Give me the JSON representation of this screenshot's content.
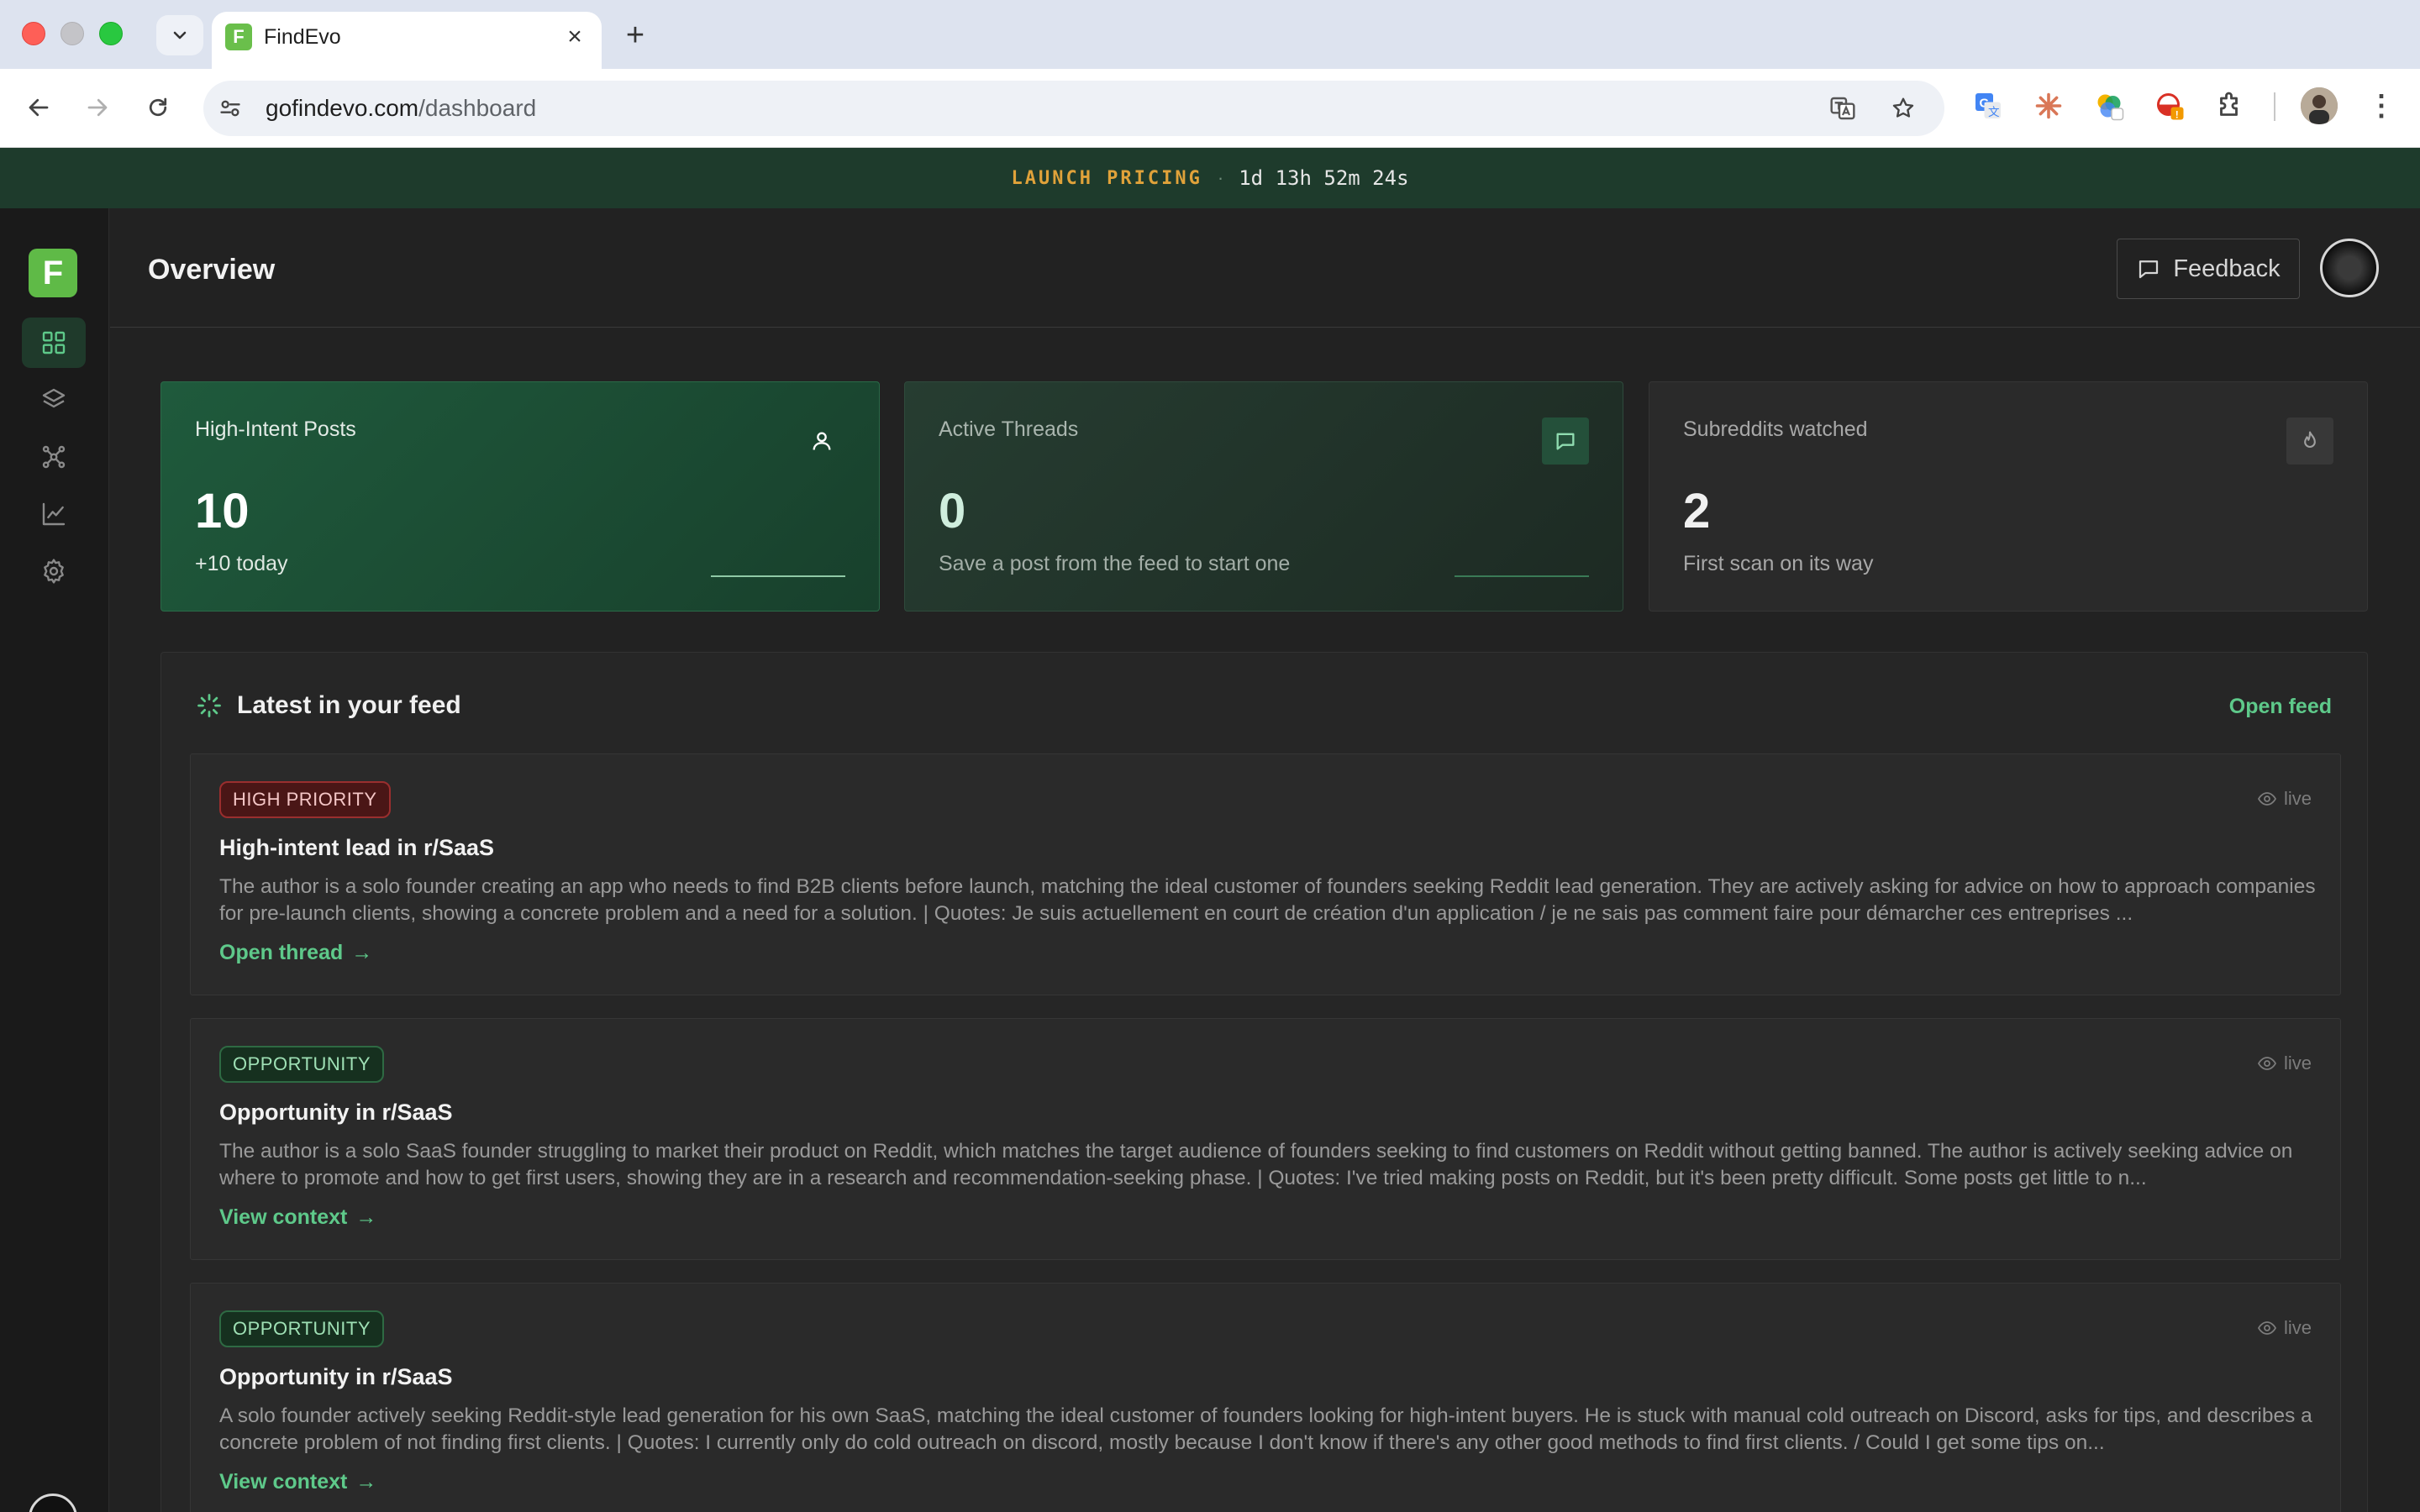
{
  "browser": {
    "tab_title": "FindEvo",
    "favicon_letter": "F",
    "url_host": "gofindevo.com",
    "url_path": "/dashboard"
  },
  "banner": {
    "label": "LAUNCH PRICING",
    "separator": "·",
    "countdown": "1d 13h 52m 24s",
    "label_color": "#e0a23a"
  },
  "app": {
    "logo_letter": "F",
    "brand_color": "#5fba47",
    "accent_color": "#5ec98a",
    "nav": [
      {
        "icon": "grid-icon",
        "active": true
      },
      {
        "icon": "layers-icon",
        "active": false
      },
      {
        "icon": "network-icon",
        "active": false
      },
      {
        "icon": "chart-icon",
        "active": false
      },
      {
        "icon": "gear-icon",
        "active": false
      }
    ]
  },
  "header": {
    "title": "Overview",
    "feedback_label": "Feedback"
  },
  "stats": [
    {
      "title": "High-Intent Posts",
      "value": "10",
      "sub": "+10 today",
      "icon": "user-icon"
    },
    {
      "title": "Active Threads",
      "value": "0",
      "sub": "Save a post from the feed to start one",
      "icon": "message-icon"
    },
    {
      "title": "Subreddits watched",
      "value": "2",
      "sub": "First scan on its way",
      "icon": "flame-icon"
    }
  ],
  "feed": {
    "title": "Latest in your feed",
    "open_label": "Open feed",
    "items": [
      {
        "badge": "HIGH PRIORITY",
        "status": "live",
        "title": "High-intent lead in r/SaaS",
        "description": "The author is a solo founder creating an app who needs to find B2B clients before launch, matching the ideal customer of founders seeking Reddit lead generation. They are actively asking for advice on how to approach companies for pre-launch clients, showing a concrete problem and a need for a solution. | Quotes: Je suis actuellement en court de création d'un application / je ne sais pas comment faire pour démarcher ces entreprises ...",
        "link": "Open thread"
      },
      {
        "badge": "OPPORTUNITY",
        "status": "live",
        "title": "Opportunity in r/SaaS",
        "description": "The author is a solo SaaS founder struggling to market their product on Reddit, which matches the target audience of founders seeking to find customers on Reddit without getting banned. The author is actively seeking advice on where to promote and how to get first users, showing they are in a research and recommendation-seeking phase. | Quotes: I've tried making posts on Reddit, but it's been pretty difficult. Some posts get little to n...",
        "link": "View context"
      },
      {
        "badge": "OPPORTUNITY",
        "status": "live",
        "title": "Opportunity in r/SaaS",
        "description": "A solo founder actively seeking Reddit-style lead generation for his own SaaS, matching the ideal customer of founders looking for high-intent buyers. He is stuck with manual cold outreach on Discord, asks for tips, and describes a concrete problem of not finding first clients. | Quotes: I currently only do cold outreach on discord, mostly because I don't know if there's any other good methods to find first clients. / Could I get some tips on...",
        "link": "View context"
      }
    ]
  }
}
